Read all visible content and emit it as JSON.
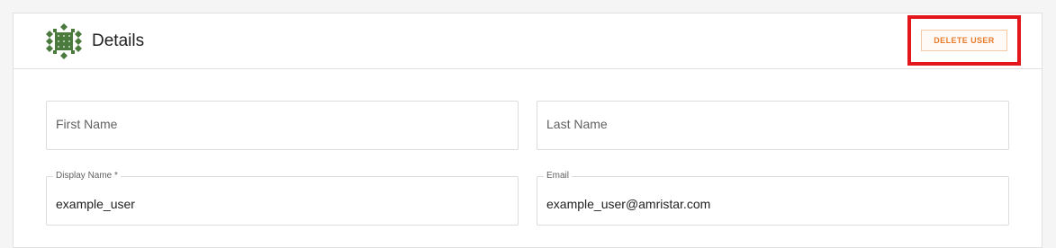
{
  "header": {
    "title": "Details",
    "avatar_icon": "green-diamond-pattern-avatar",
    "avatar_color": "#4a7a3c",
    "delete_button_label": "DELETE USER",
    "highlight_color": "#e3161c"
  },
  "form": {
    "first_name": {
      "placeholder": "First Name",
      "value": ""
    },
    "last_name": {
      "placeholder": "Last Name",
      "value": ""
    },
    "display_name": {
      "label": "Display Name *",
      "value": "example_user"
    },
    "email": {
      "label": "Email",
      "value": "example_user@amristar.com"
    }
  }
}
